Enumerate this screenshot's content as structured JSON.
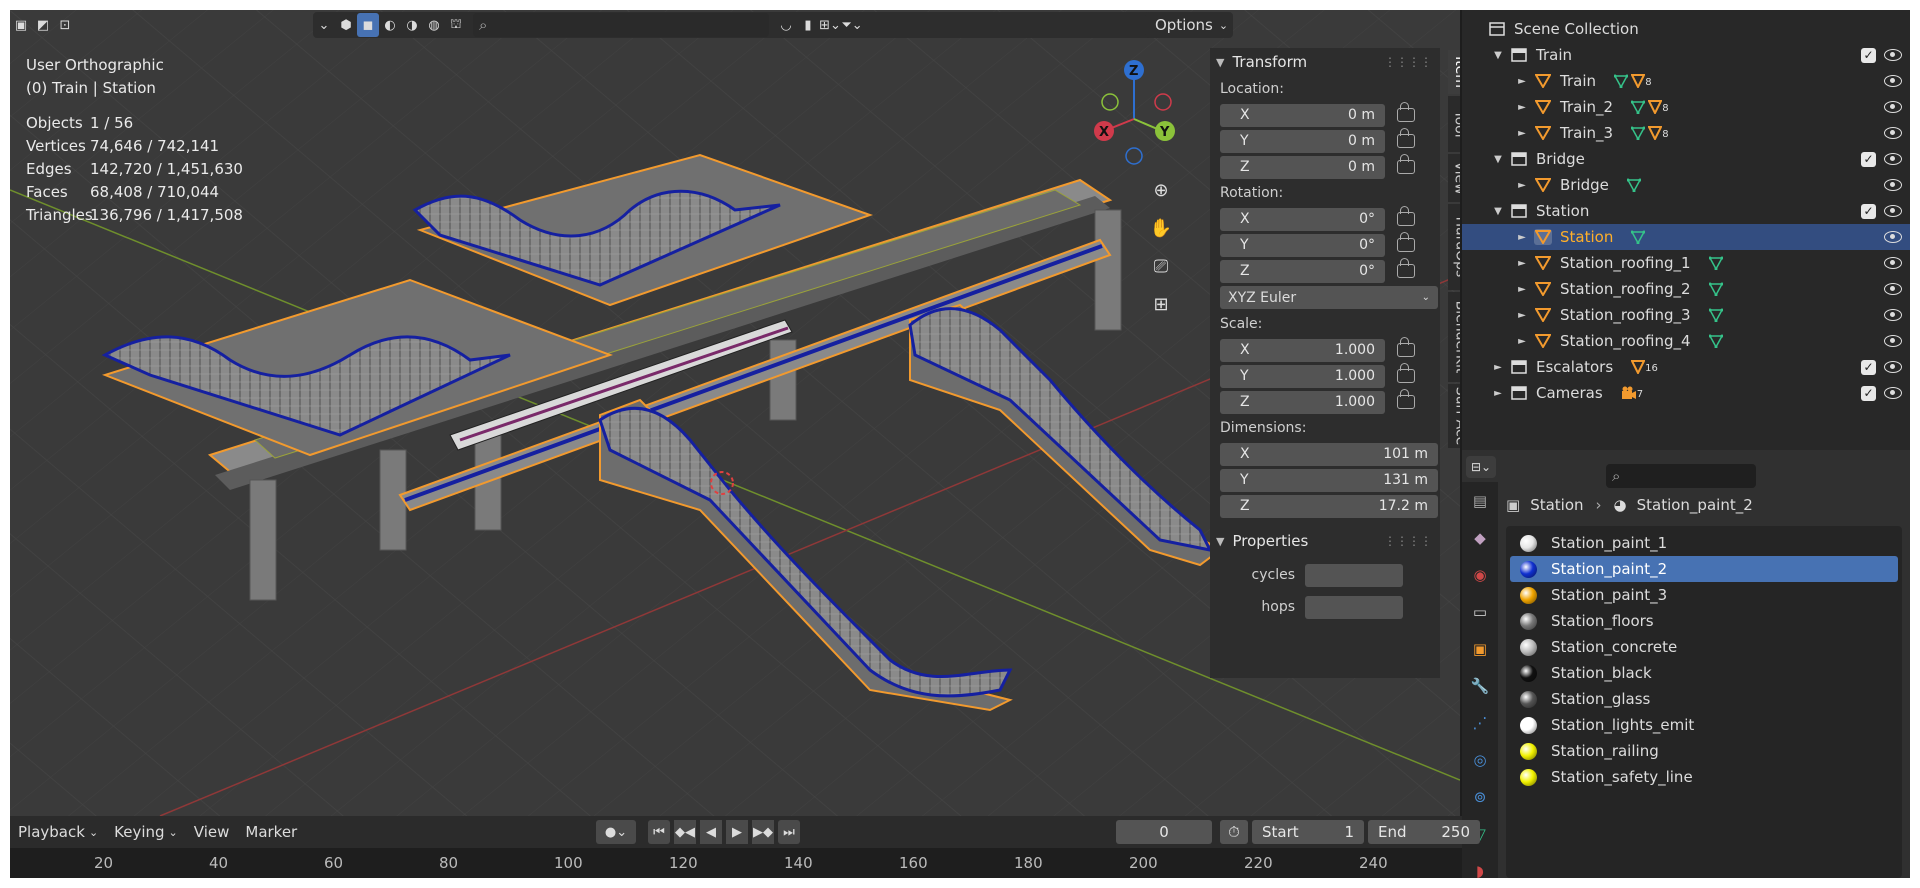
{
  "viewport": {
    "view_name": "User Orthographic",
    "context": "(0) Train | Station",
    "stats": [
      {
        "label": "Objects",
        "value": "1 / 56"
      },
      {
        "label": "Vertices",
        "value": "74,646 / 742,141"
      },
      {
        "label": "Edges",
        "value": "142,720 / 1,451,630"
      },
      {
        "label": "Faces",
        "value": "68,408 / 710,044"
      },
      {
        "label": "Triangles",
        "value": "136,796 / 1,417,508"
      }
    ],
    "options_label": "Options",
    "gizmo": {
      "x": "X",
      "y": "Y",
      "z": "Z"
    }
  },
  "npanel": {
    "transform_title": "Transform",
    "location_label": "Location:",
    "location": [
      {
        "axis": "X",
        "value": "0 m"
      },
      {
        "axis": "Y",
        "value": "0 m"
      },
      {
        "axis": "Z",
        "value": "0 m"
      }
    ],
    "rotation_label": "Rotation:",
    "rotation": [
      {
        "axis": "X",
        "value": "0°"
      },
      {
        "axis": "Y",
        "value": "0°"
      },
      {
        "axis": "Z",
        "value": "0°"
      }
    ],
    "rotation_mode": "XYZ Euler",
    "scale_label": "Scale:",
    "scale": [
      {
        "axis": "X",
        "value": "1.000"
      },
      {
        "axis": "Y",
        "value": "1.000"
      },
      {
        "axis": "Z",
        "value": "1.000"
      }
    ],
    "dimensions_label": "Dimensions:",
    "dimensions": [
      {
        "axis": "X",
        "value": "101 m"
      },
      {
        "axis": "Y",
        "value": "131 m"
      },
      {
        "axis": "Z",
        "value": "17.2 m"
      }
    ],
    "properties_title": "Properties",
    "custom_props": [
      {
        "label": "cycles"
      },
      {
        "label": "hops"
      }
    ],
    "tabs": [
      "Item",
      "Tool",
      "View",
      "HardOps",
      "BlenderKit",
      "Surf Ace"
    ]
  },
  "outliner": {
    "rows": [
      {
        "name": "Scene Collection",
        "type": "scene",
        "depth": 0,
        "expand": "",
        "check": false,
        "eye": false,
        "tag": "",
        "tagnum": ""
      },
      {
        "name": "Train",
        "type": "collection",
        "depth": 1,
        "expand": "▼",
        "check": true,
        "eye": true,
        "tag": "",
        "tagnum": ""
      },
      {
        "name": "Train",
        "type": "mesh",
        "depth": 2,
        "expand": "►",
        "check": false,
        "eye": true,
        "tag": "gm",
        "tagnum": "8"
      },
      {
        "name": "Train_2",
        "type": "mesh",
        "depth": 2,
        "expand": "►",
        "check": false,
        "eye": true,
        "tag": "gm",
        "tagnum": "8"
      },
      {
        "name": "Train_3",
        "type": "mesh",
        "depth": 2,
        "expand": "►",
        "check": false,
        "eye": true,
        "tag": "gm",
        "tagnum": "8"
      },
      {
        "name": "Bridge",
        "type": "collection",
        "depth": 1,
        "expand": "▼",
        "check": true,
        "eye": true,
        "tag": "",
        "tagnum": ""
      },
      {
        "name": "Bridge",
        "type": "mesh",
        "depth": 2,
        "expand": "►",
        "check": false,
        "eye": true,
        "tag": "g",
        "tagnum": ""
      },
      {
        "name": "Station",
        "type": "collection",
        "depth": 1,
        "expand": "▼",
        "check": true,
        "eye": true,
        "tag": "",
        "tagnum": ""
      },
      {
        "name": "Station",
        "type": "mesh",
        "depth": 2,
        "expand": "►",
        "check": false,
        "eye": true,
        "tag": "g",
        "tagnum": "",
        "selected": true
      },
      {
        "name": "Station_roofing_1",
        "type": "mesh",
        "depth": 2,
        "expand": "►",
        "check": false,
        "eye": true,
        "tag": "g",
        "tagnum": ""
      },
      {
        "name": "Station_roofing_2",
        "type": "mesh",
        "depth": 2,
        "expand": "►",
        "check": false,
        "eye": true,
        "tag": "g",
        "tagnum": ""
      },
      {
        "name": "Station_roofing_3",
        "type": "mesh",
        "depth": 2,
        "expand": "►",
        "check": false,
        "eye": true,
        "tag": "g",
        "tagnum": ""
      },
      {
        "name": "Station_roofing_4",
        "type": "mesh",
        "depth": 2,
        "expand": "►",
        "check": false,
        "eye": true,
        "tag": "g",
        "tagnum": ""
      },
      {
        "name": "Escalators",
        "type": "collection",
        "depth": 1,
        "expand": "►",
        "check": true,
        "eye": true,
        "tag": "m",
        "tagnum": "16"
      },
      {
        "name": "Cameras",
        "type": "collection",
        "depth": 1,
        "expand": "►",
        "check": true,
        "eye": true,
        "tag": "c",
        "tagnum": "7"
      }
    ]
  },
  "properties": {
    "breadcrumb_object": "Station",
    "breadcrumb_material": "Station_paint_2",
    "materials": [
      {
        "name": "Station_paint_1",
        "color": "#e6e6e6"
      },
      {
        "name": "Station_paint_2",
        "color": "#1030d0",
        "selected": true
      },
      {
        "name": "Station_paint_3",
        "color": "#f0a400"
      },
      {
        "name": "Station_floors",
        "color": "#777777"
      },
      {
        "name": "Station_concrete",
        "color": "#bdbdbd"
      },
      {
        "name": "Station_black",
        "color": "#111111"
      },
      {
        "name": "Station_glass",
        "color": "#555555"
      },
      {
        "name": "Station_lights_emit",
        "color": "#ffffff"
      },
      {
        "name": "Station_railing",
        "color": "#f2f200"
      },
      {
        "name": "Station_safety_line",
        "color": "#f2f200"
      }
    ]
  },
  "timeline": {
    "menus": [
      "Playback",
      "Keying",
      "View",
      "Marker"
    ],
    "current_frame": "0",
    "start_label": "Start",
    "start": "1",
    "end_label": "End",
    "end": "250",
    "ruler": [
      "20",
      "40",
      "60",
      "80",
      "100",
      "120",
      "140",
      "160",
      "180",
      "200",
      "220",
      "240"
    ]
  },
  "colors": {
    "selection": "#4772b3",
    "active_object": "#ffaf29",
    "outline": "#f29a2e"
  }
}
